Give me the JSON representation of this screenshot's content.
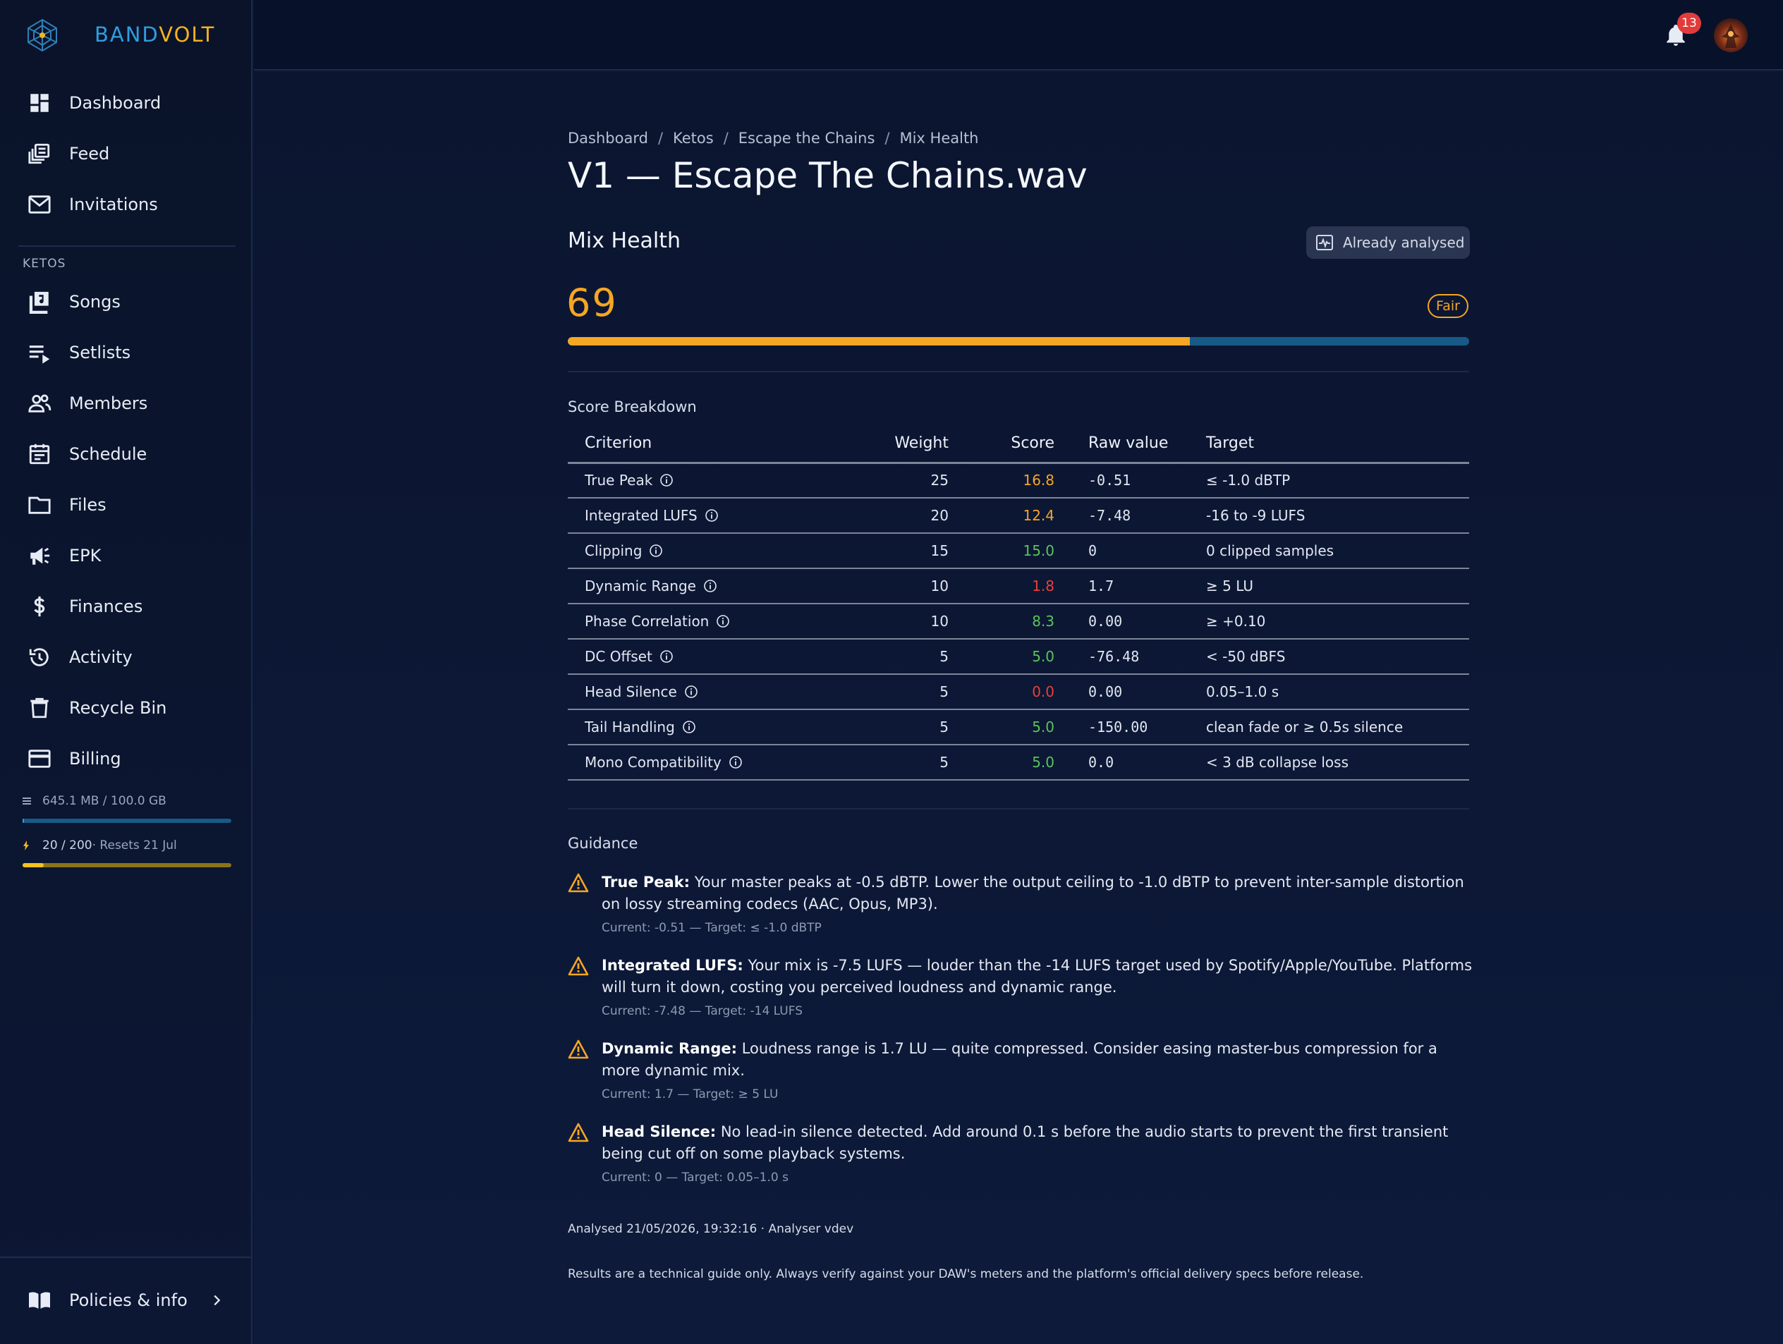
{
  "app": {
    "brand_part1": "BAND",
    "brand_part2": "VOLT",
    "brand_color_1": "#2f9ee0",
    "brand_color_2": "#f4b21f"
  },
  "sidebar": {
    "top_items": [
      {
        "label": "Dashboard",
        "icon": "dashboard-icon"
      },
      {
        "label": "Feed",
        "icon": "feed-icon"
      },
      {
        "label": "Invitations",
        "icon": "mail-icon"
      }
    ],
    "section_label": "KETOS",
    "band_items": [
      {
        "label": "Songs",
        "icon": "music-library-icon"
      },
      {
        "label": "Setlists",
        "icon": "playlist-icon"
      },
      {
        "label": "Members",
        "icon": "people-icon"
      },
      {
        "label": "Schedule",
        "icon": "calendar-icon"
      },
      {
        "label": "Files",
        "icon": "folder-icon"
      },
      {
        "label": "EPK",
        "icon": "megaphone-icon"
      },
      {
        "label": "Finances",
        "icon": "dollar-icon"
      },
      {
        "label": "Activity",
        "icon": "history-icon"
      },
      {
        "label": "Recycle Bin",
        "icon": "trash-icon"
      },
      {
        "label": "Billing",
        "icon": "credit-card-icon"
      }
    ],
    "storage": {
      "text": "645.1 MB / 100.0 GB",
      "fraction": 0.0063,
      "color": "#2f9ee0"
    },
    "credits": {
      "used": "20 / 200",
      "reset": " · Resets 21 Jul",
      "fraction": 0.1,
      "color": "#f4b21f"
    },
    "footer": {
      "label": "Policies & info",
      "icon": "book-icon"
    }
  },
  "topbar": {
    "notifications_count": "13"
  },
  "breadcrumb": [
    "Dashboard",
    "Ketos",
    "Escape the Chains",
    "Mix Health"
  ],
  "page_title": "V1 — Escape The Chains.wav",
  "mix_health": {
    "section_title": "Mix Health",
    "analysed_button": "Already analysed",
    "score": "69",
    "score_fraction": 0.69,
    "rating": "Fair",
    "accent_color": "#f5a623"
  },
  "breakdown": {
    "title": "Score Breakdown",
    "headers": {
      "criterion": "Criterion",
      "weight": "Weight",
      "score": "Score",
      "raw": "Raw value",
      "target": "Target"
    },
    "rows": [
      {
        "criterion": "True Peak",
        "weight": "25",
        "score": "16.8",
        "status": "orange",
        "raw": "-0.51",
        "target": "≤ -1.0 dBTP"
      },
      {
        "criterion": "Integrated LUFS",
        "weight": "20",
        "score": "12.4",
        "status": "orange",
        "raw": "-7.48",
        "target": "-16 to -9 LUFS"
      },
      {
        "criterion": "Clipping",
        "weight": "15",
        "score": "15.0",
        "status": "green",
        "raw": "0",
        "target": "0 clipped samples"
      },
      {
        "criterion": "Dynamic Range",
        "weight": "10",
        "score": "1.8",
        "status": "red",
        "raw": "1.7",
        "target": "≥ 5 LU"
      },
      {
        "criterion": "Phase Correlation",
        "weight": "10",
        "score": "8.3",
        "status": "green",
        "raw": "0.00",
        "target": "≥ +0.10"
      },
      {
        "criterion": "DC Offset",
        "weight": "5",
        "score": "5.0",
        "status": "green",
        "raw": "-76.48",
        "target": "< -50 dBFS"
      },
      {
        "criterion": "Head Silence",
        "weight": "5",
        "score": "0.0",
        "status": "red",
        "raw": "0.00",
        "target": "0.05–1.0 s"
      },
      {
        "criterion": "Tail Handling",
        "weight": "5",
        "score": "5.0",
        "status": "green",
        "raw": "-150.00",
        "target": "clean fade or ≥ 0.5s silence"
      },
      {
        "criterion": "Mono Compatibility",
        "weight": "5",
        "score": "5.0",
        "status": "green",
        "raw": "0.0",
        "target": "< 3 dB collapse loss"
      }
    ]
  },
  "guidance": {
    "title": "Guidance",
    "items": [
      {
        "heading": "True Peak:",
        "text": " Your master peaks at -0.5 dBTP. Lower the output ceiling to -1.0 dBTP to prevent inter-sample distortion on lossy streaming codecs (AAC, Opus, MP3).",
        "meta": "Current: -0.51 — Target: ≤ -1.0 dBTP"
      },
      {
        "heading": "Integrated LUFS:",
        "text": " Your mix is -7.5 LUFS — louder than the -14 LUFS target used by Spotify/Apple/YouTube. Platforms will turn it down, costing you perceived loudness and dynamic range.",
        "meta": "Current: -7.48 — Target: -14 LUFS"
      },
      {
        "heading": "Dynamic Range:",
        "text": " Loudness range is 1.7 LU — quite compressed. Consider easing master-bus compression for a more dynamic mix.",
        "meta": "Current: 1.7 — Target: ≥ 5 LU"
      },
      {
        "heading": "Head Silence:",
        "text": " No lead-in silence detected. Add around 0.1 s before the audio starts to prevent the first transient being cut off on some playback systems.",
        "meta": "Current: 0 — Target: 0.05–1.0 s"
      }
    ]
  },
  "footer": {
    "analysed": "Analysed 21/05/2026, 19:32:16 · Analyser vdev",
    "disclaimer": "Results are a technical guide only. Always verify against your DAW's meters and the platform's official delivery specs before release."
  }
}
